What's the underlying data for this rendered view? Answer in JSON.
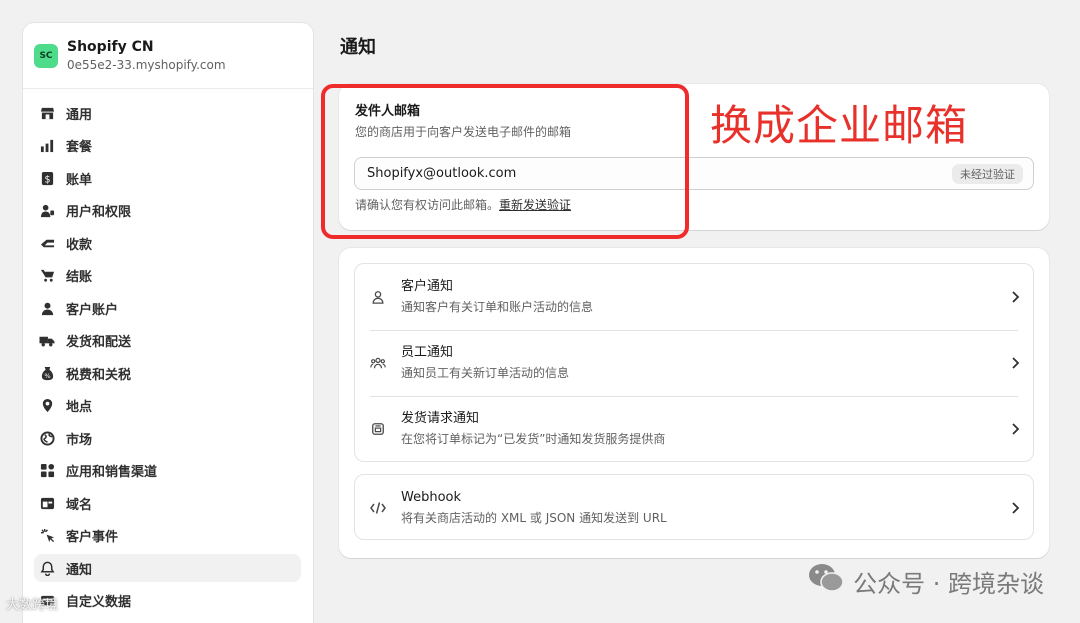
{
  "sidebar": {
    "store_avatar": "SC",
    "store_name": "Shopify CN",
    "store_domain": "0e55e2-33.myshopify.com",
    "items": [
      {
        "label": "通用",
        "icon": "store-icon"
      },
      {
        "label": "套餐",
        "icon": "plan-chart-icon"
      },
      {
        "label": "账单",
        "icon": "billing-icon"
      },
      {
        "label": "用户和权限",
        "icon": "users-icon"
      },
      {
        "label": "收款",
        "icon": "payments-icon"
      },
      {
        "label": "结账",
        "icon": "cart-icon"
      },
      {
        "label": "客户账户",
        "icon": "person-icon"
      },
      {
        "label": "发货和配送",
        "icon": "truck-icon"
      },
      {
        "label": "税费和关税",
        "icon": "tax-icon"
      },
      {
        "label": "地点",
        "icon": "location-pin-icon"
      },
      {
        "label": "市场",
        "icon": "globe-icon"
      },
      {
        "label": "应用和销售渠道",
        "icon": "apps-icon"
      },
      {
        "label": "域名",
        "icon": "domain-icon"
      },
      {
        "label": "客户事件",
        "icon": "cursor-click-icon"
      },
      {
        "label": "通知",
        "icon": "bell-icon",
        "active": true
      },
      {
        "label": "自定义数据",
        "icon": "custom-data-icon"
      }
    ]
  },
  "main": {
    "page_title": "通知",
    "sender": {
      "title": "发件人邮箱",
      "description": "您的商店用于向客户发送电子邮件的邮箱",
      "email_value": "Shopifyx@outlook.com",
      "badge": "未经过验证",
      "confirm_text": "请确认您有权访问此邮箱。",
      "resend_link": "重新发送验证"
    },
    "notifications": [
      {
        "title": "客户通知",
        "subtitle": "通知客户有关订单和账户活动的信息",
        "icon": "person-outline-icon"
      },
      {
        "title": "员工通知",
        "subtitle": "通知员工有关新订单活动的信息",
        "icon": "staff-group-icon"
      },
      {
        "title": "发货请求通知",
        "subtitle": "在您将订单标记为“已发货”时通知发货服务提供商",
        "icon": "fulfillment-request-icon"
      }
    ],
    "webhook": {
      "title": "Webhook",
      "subtitle": "将有关商店活动的 XML 或 JSON 通知发送到 URL",
      "icon": "code-icon"
    }
  },
  "annotation": {
    "text": "换成企业邮箱",
    "color": "#e8312a",
    "box_color": "#ef2b2b"
  },
  "watermark": {
    "text": "公众号 · 跨境杂谈",
    "corner_text": "大数跨境"
  }
}
